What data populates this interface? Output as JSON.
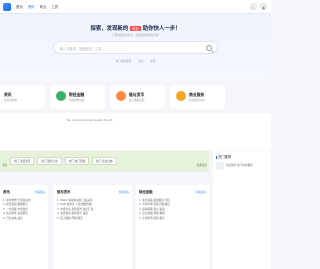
{
  "nav": {
    "items": [
      "首页",
      "资讯",
      "商业",
      "工具"
    ],
    "active_index": 1
  },
  "header_icons": [
    "moon-icon",
    "user-icon"
  ],
  "hero": {
    "title_before": "探索，发现新的",
    "title_tag": "商业",
    "title_after": "助你快人一步！",
    "subtitle": "汇聚海量优质信息，发现新的机会和可能",
    "search_placeholder": "输入关键词，搜索资讯、工具...",
    "hot_links": [
      "热门搜索推荐",
      "商业",
      "资讯"
    ]
  },
  "cards": [
    {
      "title": "资讯",
      "subtitle": "发现新鲜事",
      "icon": "news-icon",
      "color": "#ffffff"
    },
    {
      "title": "财经金融",
      "subtitle": "洞察财经动态",
      "icon": "finance-icon",
      "color": "#3ab06a"
    },
    {
      "title": "链与货币",
      "subtitle": "链上数据追踪",
      "icon": "chain-icon",
      "color": "#ff8a3d"
    },
    {
      "title": "商业服务",
      "subtitle": "商业服务动态",
      "icon": "service-icon",
      "color": "#f5a623"
    }
  ],
  "panel": {
    "empty_text": "No recommended posts found."
  },
  "banner": {
    "tags": [
      "热门 项目资讯",
      "热门 最新上线",
      "热门 热门话题",
      "热门 商业动态"
    ],
    "bottom_left": "消息",
    "bottom_right": "查看更多"
  },
  "right_box": {
    "header": "热门推荐",
    "item_text": "热点推荐 热门内容推荐"
  },
  "columns": [
    {
      "title": "资讯",
      "more": "查看更多",
      "items": [
        "1. 新年伊始 行业新动向",
        "2. 项目进展 数据报告",
        "3. 一文读懂 市场变化",
        "4. 热点事件 追踪解读",
        "5. 行业动态 速览"
      ]
    },
    {
      "title": "链与货币",
      "more": "查看更多",
      "items": [
        "1. Web3 领域新动态 引发关注",
        "2. DeFi 新协议 上线 数据亮眼",
        "3. 市场分析 趋势研判 观点汇总",
        "4. 项目融资 最新消息 速递",
        "5. 链上数据 周报 精选"
      ]
    },
    {
      "title": "财经金融",
      "more": "查看更多",
      "items": [
        "1. 央行政策 最新解读 分析",
        "2. 今年市场 表现 回顾总结",
        "3. 投资策略 观点 集锦",
        "4. 企业财报 季度 数据",
        "5. 全球经济 展望 报告"
      ]
    }
  ]
}
